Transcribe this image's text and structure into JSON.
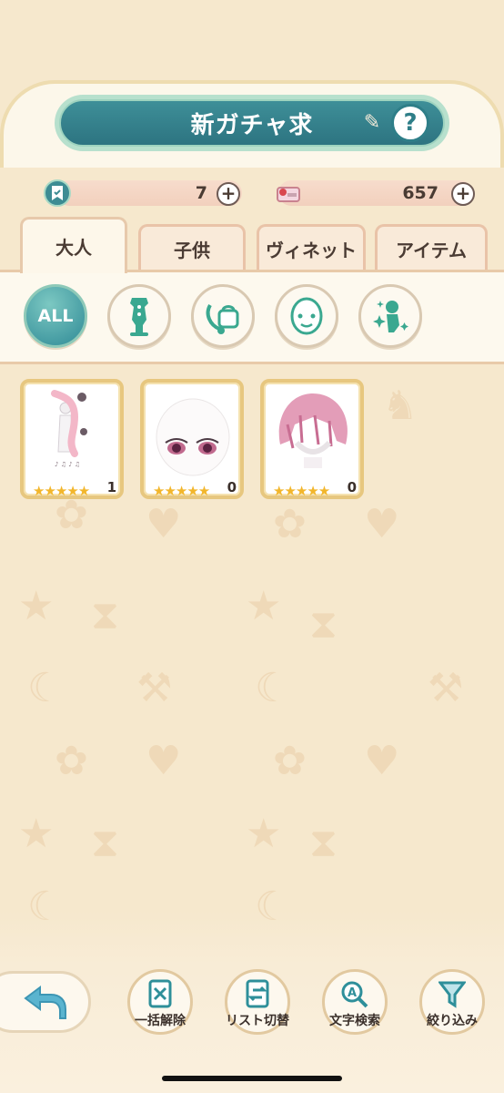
{
  "header": {
    "title": "新ガチャ求"
  },
  "currency": [
    {
      "icon": "ticket-icon",
      "value": "7"
    },
    {
      "icon": "coupon-icon",
      "value": "657"
    }
  ],
  "tabs": [
    {
      "label": "大人",
      "active": true
    },
    {
      "label": "子供",
      "active": false
    },
    {
      "label": "ヴィネット",
      "active": false
    },
    {
      "label": "アイテム",
      "active": false
    }
  ],
  "filters": [
    {
      "label": "ALL",
      "icon": "all-icon"
    },
    {
      "label": "",
      "icon": "mannequin-icon"
    },
    {
      "label": "",
      "icon": "bag-accessory-icon"
    },
    {
      "label": "",
      "icon": "face-icon"
    },
    {
      "label": "",
      "icon": "sparkle-figure-icon"
    }
  ],
  "items": [
    {
      "icon": "outfit-icon",
      "stars": "★★★★★",
      "count": "1"
    },
    {
      "icon": "face-eyes-icon",
      "stars": "★★★★★",
      "count": "0"
    },
    {
      "icon": "pink-hair-icon",
      "stars": "★★★★★",
      "count": "0"
    }
  ],
  "bottom_nav": [
    {
      "label": "一括解除",
      "icon": "clear-all-icon"
    },
    {
      "label": "リスト切替",
      "icon": "list-switch-icon"
    },
    {
      "label": "文字検索",
      "icon": "text-search-icon"
    },
    {
      "label": "絞り込み",
      "icon": "filter-funnel-icon"
    }
  ],
  "colors": {
    "teal": "#2d7481",
    "gold": "#e7c77f",
    "bg": "#f6e8cd"
  }
}
